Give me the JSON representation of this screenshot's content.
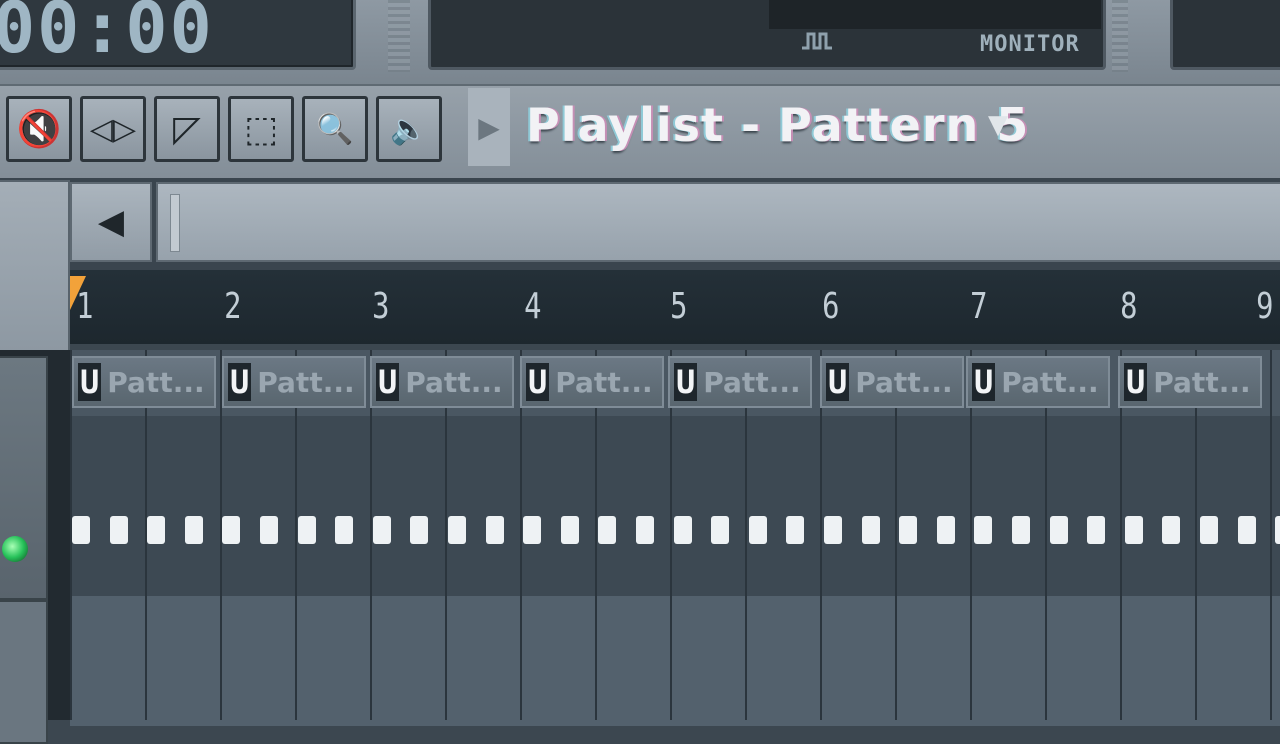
{
  "transport": {
    "time": "00:00"
  },
  "monitor": {
    "label": "MONITOR",
    "wave_icon": "waveform-icon"
  },
  "toolbar": {
    "buttons": [
      {
        "icon": "mute-speaker-icon",
        "glyph": "🔇"
      },
      {
        "icon": "slip-arrows-icon",
        "glyph": "◁▷"
      },
      {
        "icon": "slice-icon",
        "glyph": "◸"
      },
      {
        "icon": "select-icon",
        "glyph": "⬚"
      },
      {
        "icon": "zoom-icon",
        "glyph": "🔍"
      },
      {
        "icon": "speaker-icon",
        "glyph": "🔈"
      }
    ]
  },
  "playlist": {
    "title": "Playlist - Pattern 5",
    "dropdown_glyph": "▼",
    "arrow_glyph": "▶"
  },
  "scroll": {
    "left_glyph": "◀"
  },
  "ruler": {
    "bars": [
      "1",
      "2",
      "3",
      "4",
      "5",
      "6",
      "7",
      "8",
      "9"
    ]
  },
  "track1": {
    "pattern_u": "U",
    "pattern_labels": [
      "Patt...",
      "Patt...",
      "Patt...",
      "Patt...",
      "Patt...",
      "Patt...",
      "Patt...",
      "Patt..."
    ]
  },
  "colors": {
    "playhead": "#f2a23a",
    "led": "#27c25a"
  }
}
